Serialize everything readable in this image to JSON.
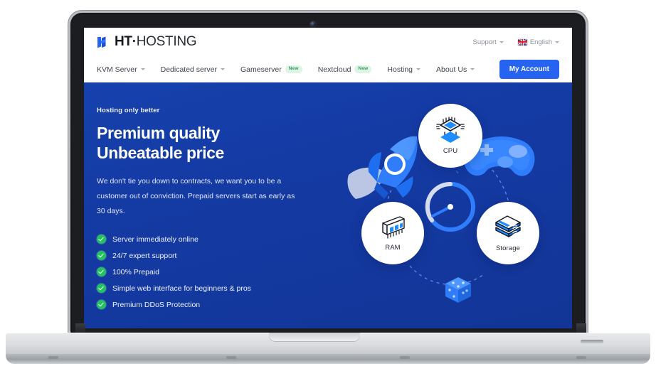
{
  "brand": {
    "logo_prefix": "HT",
    "logo_separator": "·",
    "logo_suffix": "HOSTING",
    "accent_blue": "#2563f0",
    "hero_blue": "#143aa3",
    "check_green": "#22c35e",
    "badge_green": "#2f9e5c"
  },
  "topbar": {
    "support_label": "Support",
    "language_label": "English",
    "flag_icon": "uk-flag-icon",
    "caret_icon": "chevron-down-icon"
  },
  "nav": {
    "items": [
      {
        "label": "KVM Server",
        "has_caret": true,
        "badge": ""
      },
      {
        "label": "Dedicated server",
        "has_caret": true,
        "badge": ""
      },
      {
        "label": "Gameserver",
        "has_caret": false,
        "badge": "New"
      },
      {
        "label": "Nextcloud",
        "has_caret": false,
        "badge": "New"
      },
      {
        "label": "Hosting",
        "has_caret": true,
        "badge": ""
      },
      {
        "label": "About Us",
        "has_caret": true,
        "badge": ""
      }
    ],
    "account_button": "My Account"
  },
  "hero": {
    "eyebrow": "Hosting only better",
    "headline": "Premium quality Unbeatable price",
    "subcopy": "We don't tie you down to contracts, we want you to be a customer out of conviction. Prepaid servers start as early as 30 days.",
    "features": [
      "Server immediately online",
      "24/7 expert support",
      "100% Prepaid",
      "Simple web interface for beginners & pros",
      "Premium DDoS Protection"
    ]
  },
  "illustration": {
    "circles": [
      {
        "label": "CPU",
        "icon": "cpu-chip-icon"
      },
      {
        "label": "RAM",
        "icon": "ram-module-icon"
      },
      {
        "label": "Storage",
        "icon": "storage-disk-icon"
      }
    ],
    "decorations": [
      {
        "icon": "rocket-icon"
      },
      {
        "icon": "gamepad-icon"
      },
      {
        "icon": "dice-icon"
      },
      {
        "icon": "speed-gauge-icon"
      }
    ]
  },
  "device": {
    "type": "laptop-mockup",
    "webcam": "webcam-icon"
  }
}
